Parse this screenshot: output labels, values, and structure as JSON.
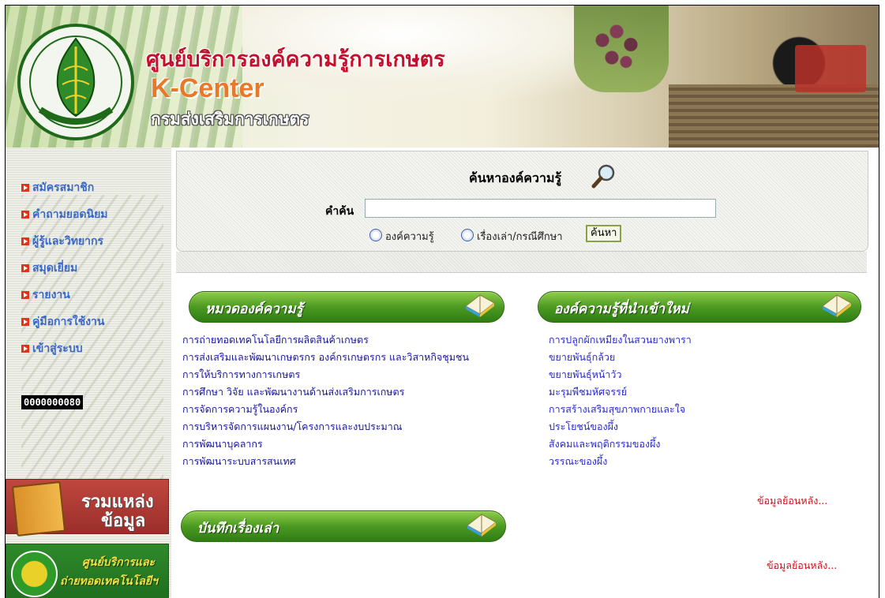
{
  "banner": {
    "title_th": "ศูนย์บริการองค์ความรู้การเกษตร",
    "title_en": "K-Center",
    "department": "กรมส่งเสริมการเกษตร"
  },
  "sidebar": {
    "items": [
      {
        "label": "สมัครสมาชิก"
      },
      {
        "label": "คำถามยอดนิยม"
      },
      {
        "label": "ผู้รู้และวิทยากร"
      },
      {
        "label": "สมุดเยี่ยม"
      },
      {
        "label": "รายงาน"
      },
      {
        "label": "คู่มือการใช้งาน"
      },
      {
        "label": "เข้าสู่ระบบ"
      }
    ],
    "counter": "0000000080",
    "promo_sources": {
      "line1": "รวมแหล่ง",
      "line2": "ข้อมูล"
    },
    "promo_center": {
      "line1": "ศูนย์บริการและ",
      "line2": "ถ่ายทอดเทคโนโลยีฯ"
    }
  },
  "search": {
    "title": "ค้นหาองค์ความรู้",
    "keyword_label": "คำค้น",
    "keyword_value": "",
    "radio_knowledge": "องค์ความรู้",
    "radio_story": "เรื่องเล่า/กรณีศึกษา",
    "button_label": "ค้นหา"
  },
  "categories": {
    "header": "หมวดองค์ความรู้",
    "items": [
      "การถ่ายทอดเทคโนโลยีการผลิตสินค้าเกษตร",
      "การส่งเสริมและพัฒนาเกษตรกร องค์กรเกษตรกร และวิสาหกิจชุมชน",
      "การให้บริการทางการเกษตร",
      "การศึกษา วิจัย และพัฒนางานด้านส่งเสริมการเกษตร",
      "การจัดการความรู้ในองค์กร",
      "การบริหารจัดการแผนงาน/โครงการและงบประมาณ",
      "การพัฒนาบุคลากร",
      "การพัฒนาระบบสารสนเทศ"
    ]
  },
  "new_knowledge": {
    "header": "องค์ความรู้ที่นำเข้าใหม่",
    "items": [
      "การปลูกผักเหมียงในสวนยางพารา",
      "ขยายพันธุ์กล้วย",
      "ขยายพันธุ์หน้าวัว",
      "มะรุมพืชมหัศจรรย์",
      "การสร้างเสริมสุขภาพกายและใจ",
      "ประโยชน์ของผึ้ง",
      "สังคมและพฤติกรรมของผึ้ง",
      "วรรณะของผึ้ง"
    ],
    "more": "ข้อมูลย้อนหลัง..."
  },
  "stories": {
    "header": "บันทึกเรื่องเล่า",
    "more": "ข้อมูลย้อนหลัง..."
  },
  "colors": {
    "title_red": "#c3102d",
    "kcenter_orange": "#e8782a",
    "menu_blue": "#3a68c4",
    "link_dark": "#17169a",
    "link_blue": "#2a2acc",
    "more_red": "#c8141a",
    "section_green": "#4c9a22"
  }
}
